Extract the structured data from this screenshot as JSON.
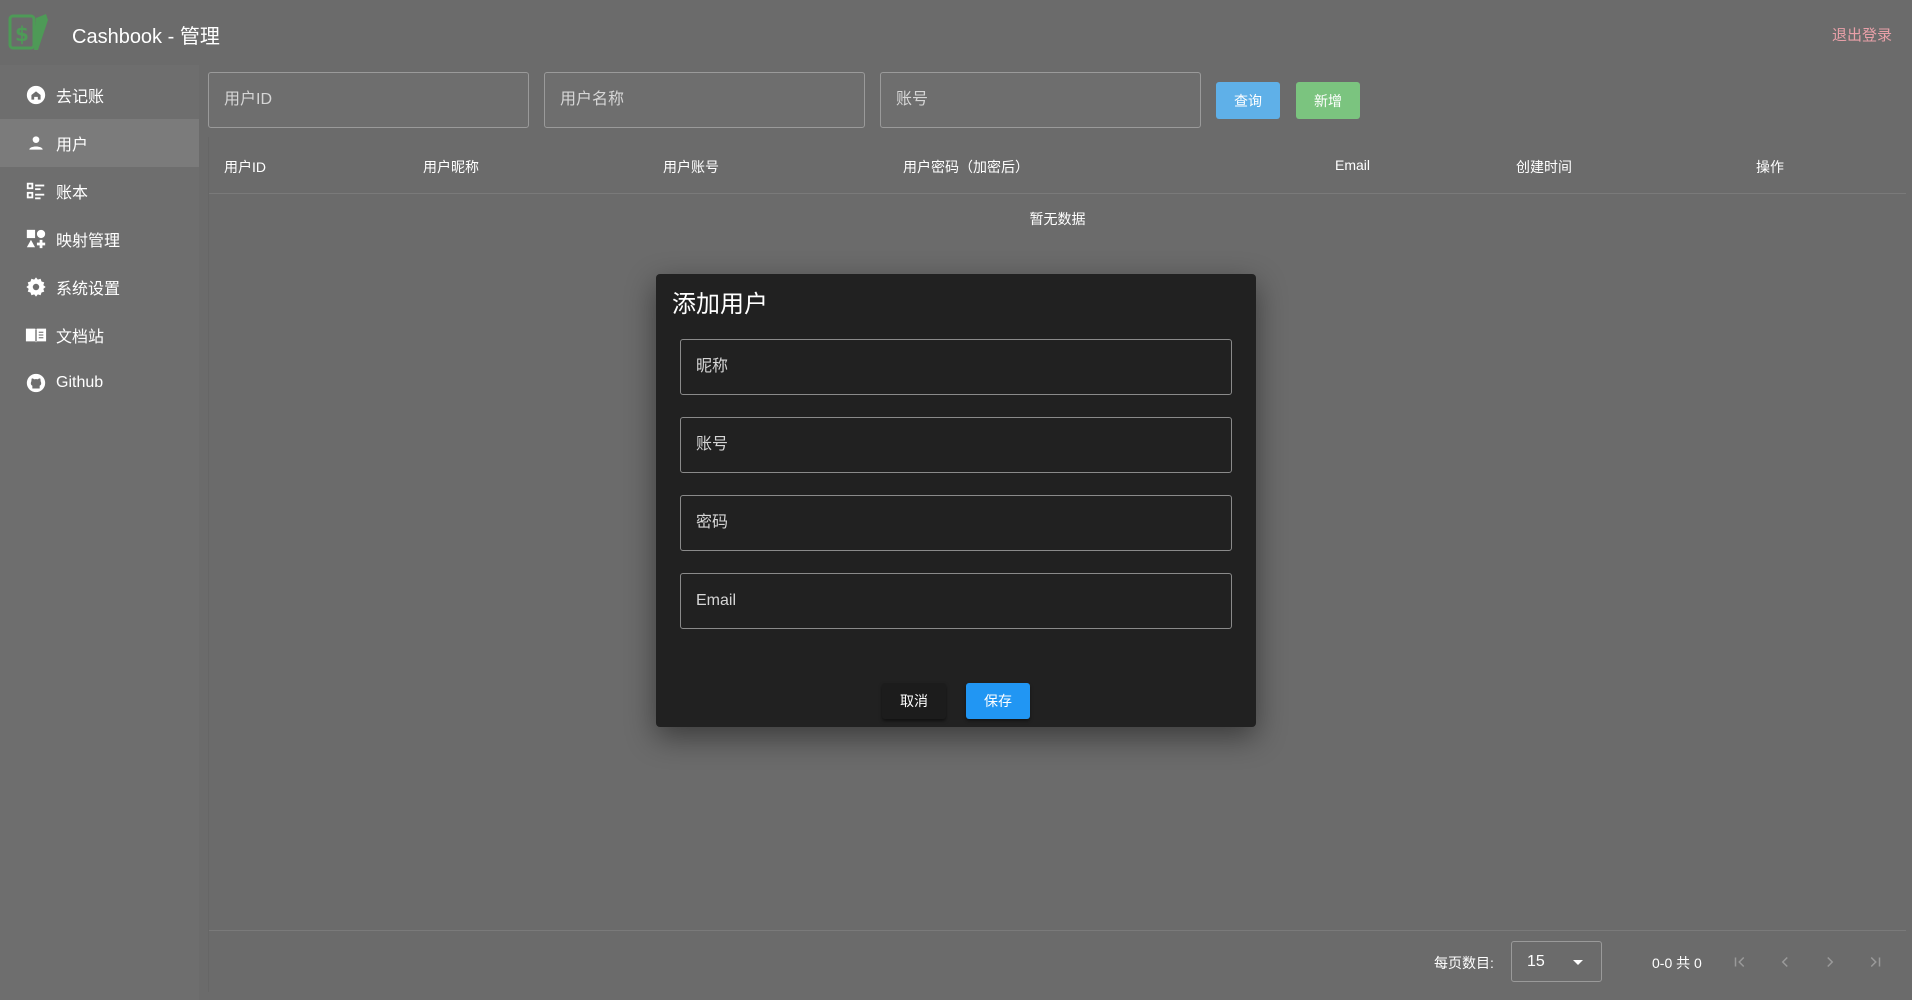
{
  "header": {
    "title": "Cashbook - 管理",
    "logout_label": "退出登录"
  },
  "sidebar": {
    "items": [
      {
        "label": "去记账",
        "icon": "home-icon"
      },
      {
        "label": "用户",
        "icon": "user-icon",
        "active": true
      },
      {
        "label": "账本",
        "icon": "list-icon"
      },
      {
        "label": "映射管理",
        "icon": "mapping-icon"
      },
      {
        "label": "系统设置",
        "icon": "gear-icon"
      },
      {
        "label": "文档站",
        "icon": "book-icon"
      },
      {
        "label": "Github",
        "icon": "github-icon"
      }
    ]
  },
  "filters": {
    "user_id_placeholder": "用户ID",
    "user_name_placeholder": "用户名称",
    "account_placeholder": "账号",
    "query_label": "查询",
    "add_label": "新增"
  },
  "table": {
    "columns": [
      "用户ID",
      "用户昵称",
      "用户账号",
      "用户密码（加密后）",
      "Email",
      "创建时间",
      "操作"
    ],
    "empty_text": "暂无数据"
  },
  "pagination": {
    "per_page_label": "每页数目:",
    "per_page_value": "15",
    "range_text": "0-0 共 0"
  },
  "dialog": {
    "title": "添加用户",
    "nickname_placeholder": "昵称",
    "account_placeholder": "账号",
    "password_placeholder": "密码",
    "email_placeholder": "Email",
    "cancel_label": "取消",
    "save_label": "保存"
  },
  "colors": {
    "background": "#6b6b6b",
    "dialog_bg": "#212121",
    "primary": "#2196f3",
    "query_button": "#5fb0e8",
    "add_button": "#7bc47f",
    "logout": "#e8a0a8",
    "logo": "#4caf50"
  }
}
